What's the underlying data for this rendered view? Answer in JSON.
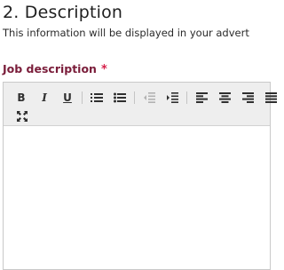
{
  "section": {
    "title": "2. Description",
    "subtitle": "This information will be displayed in your advert"
  },
  "job_description": {
    "label": "Job description",
    "required_marker": "*",
    "toolbar": {
      "bold": "B",
      "italic": "I",
      "underline": "U",
      "buttons": [
        "bold-icon",
        "italic-icon",
        "underline-icon",
        "numbered-list-icon",
        "bulleted-list-icon",
        "decrease-indent-icon",
        "increase-indent-icon",
        "align-left-icon",
        "align-center-icon",
        "align-right-icon",
        "align-justify-icon",
        "maximize-icon"
      ]
    },
    "content": ""
  },
  "colors": {
    "label": "#7a1d3a",
    "required": "#d6204a",
    "toolbar_bg": "#eeeeee"
  }
}
